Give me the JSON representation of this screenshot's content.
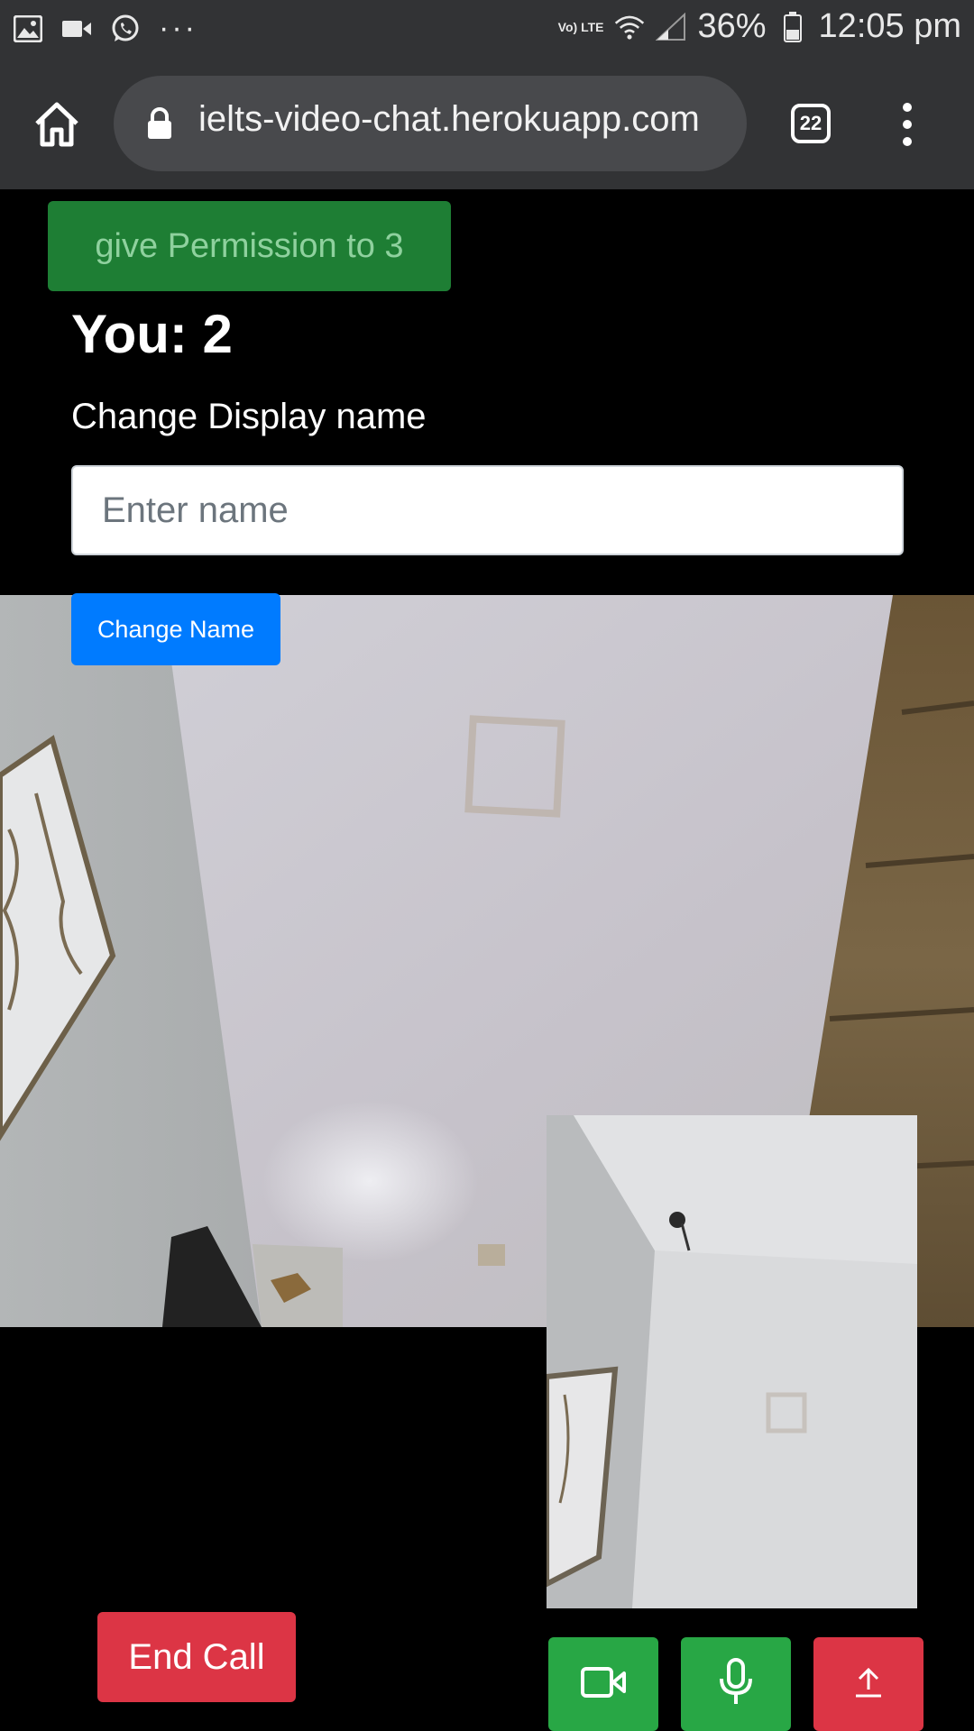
{
  "status_bar": {
    "left_icons": [
      "gallery-icon",
      "video-camera-icon",
      "whatsapp-icon",
      "more-dots-icon"
    ],
    "volte": "Vo) LTE",
    "battery": "36%",
    "time": "12:05 pm"
  },
  "browser": {
    "url": "ielts-video-chat.herokuapp.com",
    "tab_count": "22"
  },
  "page": {
    "permission_button": "give Permission to 3",
    "you_label": "You: 2",
    "change_display_label": "Change Display name",
    "name_input": {
      "placeholder": "Enter name",
      "value": ""
    },
    "change_name_button": "Change Name",
    "end_call_button": "End Call"
  },
  "colors": {
    "permission_bg": "#1e7e34",
    "primary": "#007bff",
    "success": "#28a745",
    "danger": "#dc3545",
    "chrome_bg": "#323335"
  }
}
